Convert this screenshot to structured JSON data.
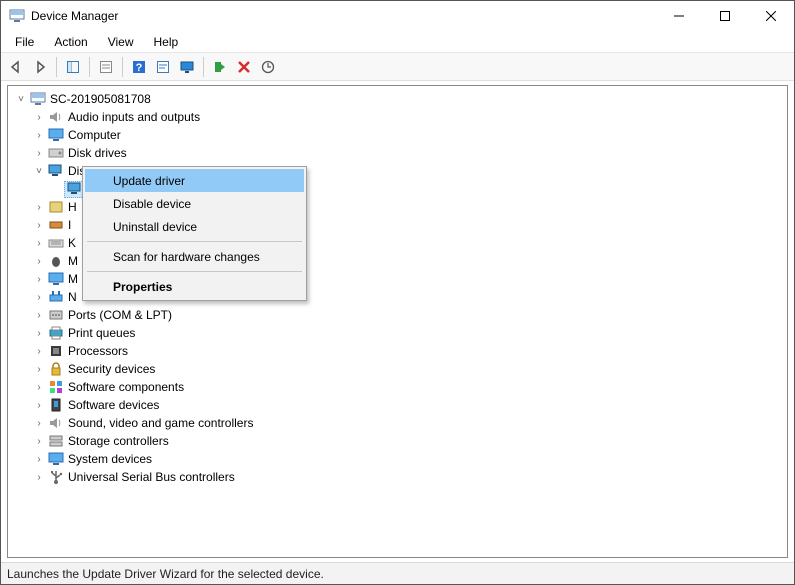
{
  "window": {
    "title": "Device Manager"
  },
  "menu": {
    "file": "File",
    "action": "Action",
    "view": "View",
    "help": "Help"
  },
  "tree": {
    "root": "SC-201905081708",
    "items": [
      {
        "label": "Audio inputs and outputs",
        "expandable": true
      },
      {
        "label": "Computer",
        "expandable": true
      },
      {
        "label": "Disk drives",
        "expandable": true
      },
      {
        "label": "Display adapters",
        "expandable": true,
        "expanded": true
      },
      {
        "label": "H",
        "expandable": true,
        "truncated": true
      },
      {
        "label": "I",
        "expandable": true,
        "truncated": true
      },
      {
        "label": "K",
        "expandable": true,
        "truncated": true
      },
      {
        "label": "M",
        "expandable": true,
        "truncated": true
      },
      {
        "label": "M",
        "expandable": true,
        "truncated": true
      },
      {
        "label": "N",
        "expandable": true,
        "truncated": true
      },
      {
        "label": "Ports (COM & LPT)",
        "expandable": true
      },
      {
        "label": "Print queues",
        "expandable": true
      },
      {
        "label": "Processors",
        "expandable": true
      },
      {
        "label": "Security devices",
        "expandable": true
      },
      {
        "label": "Software components",
        "expandable": true
      },
      {
        "label": "Software devices",
        "expandable": true
      },
      {
        "label": "Sound, video and game controllers",
        "expandable": true
      },
      {
        "label": "Storage controllers",
        "expandable": true
      },
      {
        "label": "System devices",
        "expandable": true
      },
      {
        "label": "Universal Serial Bus controllers",
        "expandable": true
      }
    ],
    "selected_child_label": ""
  },
  "context_menu": {
    "items": [
      {
        "label": "Update driver",
        "highlighted": true
      },
      {
        "label": "Disable device"
      },
      {
        "label": "Uninstall device"
      }
    ],
    "scan": "Scan for hardware changes",
    "properties": "Properties"
  },
  "status": "Launches the Update Driver Wizard for the selected device."
}
